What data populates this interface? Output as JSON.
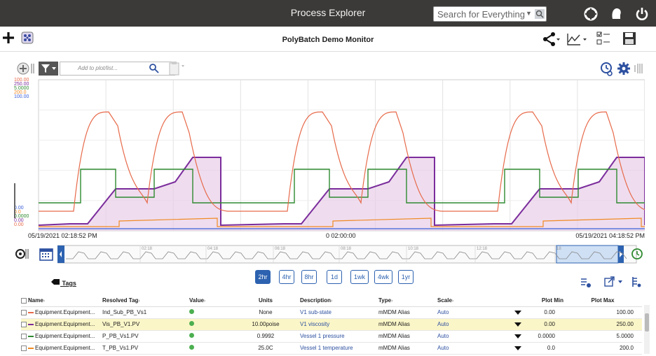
{
  "app": {
    "title": "Process Explorer",
    "search_placeholder": "Search for Everything",
    "document_title": "PolyBatch Demo Monitor"
  },
  "colors": {
    "topbar": "#3c3a38",
    "accent": "#2d62b0",
    "series_substate": "#e76a4a",
    "series_viscosity": "#7b2d9c",
    "series_pressure": "#2f8a30",
    "series_temperature": "#f08a24",
    "series_blue": "#3a5fd8"
  },
  "toolbar": {
    "plot_placeholder": "Add to plot/list..."
  },
  "plot": {
    "scale_labels": [
      {
        "text": "100.00",
        "color": "#e76a4a"
      },
      {
        "text": "250.00",
        "color": "#7b2d9c"
      },
      {
        "text": "5.0000",
        "color": "#2f8a30"
      },
      {
        "text": "200.0",
        "color": "#f08a24"
      },
      {
        "text": "100.00",
        "color": "#3a5fd8"
      }
    ],
    "bottom_labels": [
      {
        "text": "0.00",
        "color": "#3a5fd8"
      },
      {
        "text": "0.0",
        "color": "#f08a24"
      },
      {
        "text": "0.0000",
        "color": "#2f8a30"
      },
      {
        "text": "0.00",
        "color": "#7b2d9c"
      },
      {
        "text": "0.00",
        "color": "#e76a4a"
      }
    ],
    "start_time": "05/19/2021 02:18:52 PM",
    "duration": "0 02:00:00",
    "end_time": "05/19/2021 04:18:52 PM"
  },
  "timeline": {
    "tick_labels": [
      "02:18",
      "04:18",
      "06:18",
      "08:18",
      "10:18",
      "12:18",
      "18"
    ]
  },
  "ranges": [
    {
      "label": "2hr",
      "active": true
    },
    {
      "label": "4hr",
      "active": false
    },
    {
      "label": "8hr",
      "active": false
    },
    {
      "label": "1d",
      "active": false
    },
    {
      "label": "1wk",
      "active": false
    },
    {
      "label": "4wk",
      "active": false
    },
    {
      "label": "1yr",
      "active": false
    }
  ],
  "tags_label": "Tags",
  "table": {
    "headers": {
      "name": "Name",
      "resolved_tag": "Resolved Tag",
      "value": "Value",
      "units": "Units",
      "description": "Description",
      "type": "Type",
      "scale": "Scale",
      "plot_min": "Plot Min",
      "plot_max": "Plot Max"
    },
    "rows": [
      {
        "name": "Equipment.Equipment...",
        "resolved_tag": "Ind_Sub_PB_Vs1",
        "units": "None",
        "description": "V1 sub-state",
        "type": "mMDM Alias",
        "scale": "Auto",
        "plot_min": "0.00",
        "plot_max": "100.00",
        "color": "#e76a4a"
      },
      {
        "name": "Equipment.Equipment...",
        "resolved_tag": "Vis_PB_V1.PV",
        "units": "10.00poise",
        "description": "V1 viscosity",
        "type": "mMDM Alias",
        "scale": "Auto",
        "plot_min": "0.00",
        "plot_max": "250.00",
        "color": "#7b2d9c"
      },
      {
        "name": "Equipment.Equipment...",
        "resolved_tag": "P_PB_Vs1.PV",
        "units": "0.9992",
        "description": "Vessel 1 pressure",
        "type": "mMDM Alias",
        "scale": "Auto",
        "plot_min": "0.0000",
        "plot_max": "5.0000",
        "color": "#2f8a30"
      },
      {
        "name": "Equipment.Equipment...",
        "resolved_tag": "T_PB_Vs1.PV",
        "units": "25.0C",
        "description": "Vessel 1 temperature",
        "type": "mMDM Alias",
        "scale": "Auto",
        "plot_min": "0.0",
        "plot_max": "200.0",
        "color": "#f08a24"
      }
    ]
  }
}
